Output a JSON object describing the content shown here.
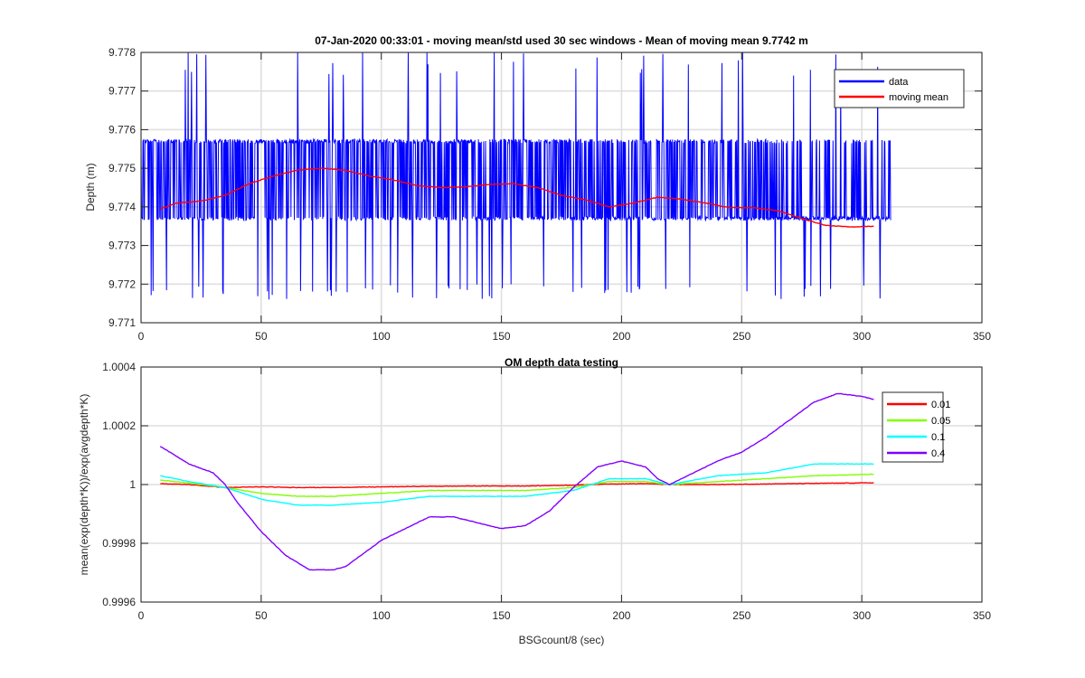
{
  "chart_data": [
    {
      "type": "line",
      "title": "07-Jan-2020 00:33:01 - moving mean/std used 30 sec windows - Mean of moving mean 9.7742 m",
      "xlabel": "",
      "ylabel": "Depth (m)",
      "xlim": [
        0,
        350
      ],
      "ylim": [
        9.771,
        9.778
      ],
      "xticks": [
        0,
        50,
        100,
        150,
        200,
        250,
        300,
        350
      ],
      "yticks": [
        9.771,
        9.772,
        9.773,
        9.774,
        9.775,
        9.776,
        9.777,
        9.778
      ],
      "ytick_labels": [
        "9.771",
        "9.772",
        "9.773",
        "9.774",
        "9.775",
        "9.776",
        "9.777",
        "9.778"
      ],
      "grid": true,
      "legend_position": "top-right",
      "series": [
        {
          "name": "data",
          "color": "#0000ff",
          "style": "noisy",
          "x_range": [
            0,
            312
          ],
          "base_levels": [
            9.7737,
            9.7757
          ],
          "spike_levels": [
            9.7716,
            9.7774,
            9.778
          ],
          "x": [
            0,
            10,
            20,
            30,
            40,
            50,
            60,
            70,
            80,
            90,
            100,
            110,
            120,
            130,
            140,
            150,
            160,
            170,
            180,
            190,
            200,
            210,
            220,
            230,
            240,
            250,
            260,
            270,
            280,
            290,
            300,
            312
          ],
          "y": [
            9.7747,
            9.7748,
            9.7747,
            9.7748,
            9.7749,
            9.775,
            9.7751,
            9.7751,
            9.7751,
            9.775,
            9.7749,
            9.7748,
            9.7748,
            9.7748,
            9.7748,
            9.7748,
            9.7747,
            9.7747,
            9.7746,
            9.7745,
            9.7745,
            9.7746,
            9.7746,
            9.7745,
            9.7745,
            9.7744,
            9.7743,
            9.7742,
            9.7741,
            9.7741,
            9.7742,
            9.7742
          ]
        },
        {
          "name": "moving mean",
          "color": "#ff0000",
          "x": [
            8,
            15,
            25,
            35,
            45,
            55,
            65,
            75,
            85,
            95,
            105,
            115,
            125,
            135,
            145,
            155,
            165,
            175,
            185,
            195,
            205,
            215,
            225,
            235,
            245,
            255,
            265,
            275,
            285,
            295,
            305
          ],
          "y": [
            9.77395,
            9.7741,
            9.77415,
            9.7743,
            9.7746,
            9.7748,
            9.77495,
            9.775,
            9.77495,
            9.7748,
            9.7747,
            9.77455,
            9.7745,
            9.77452,
            9.77458,
            9.7746,
            9.7745,
            9.7743,
            9.77418,
            9.774,
            9.7741,
            9.77425,
            9.7742,
            9.7741,
            9.77398,
            9.77398,
            9.7739,
            9.7737,
            9.77352,
            9.77348,
            9.7735
          ]
        }
      ]
    },
    {
      "type": "line",
      "title": "OM depth data testing",
      "xlabel": "BSGcount/8 (sec)",
      "ylabel": "mean(exp(depth*K))/exp(avgdepth*K)",
      "xlim": [
        0,
        350
      ],
      "ylim": [
        0.9996,
        1.0004
      ],
      "xticks": [
        0,
        50,
        100,
        150,
        200,
        250,
        300,
        350
      ],
      "yticks": [
        0.9996,
        0.9998,
        1.0,
        1.0002,
        1.0004
      ],
      "ytick_labels": [
        "0.9996",
        "0.9998",
        "1",
        "1.0002",
        "1.0004"
      ],
      "grid": true,
      "legend_position": "top-right",
      "series": [
        {
          "name": "0.01",
          "color": "#ff0000",
          "x": [
            8,
            20,
            35,
            50,
            65,
            80,
            100,
            120,
            140,
            160,
            180,
            195,
            210,
            220,
            240,
            260,
            280,
            305
          ],
          "y": [
            1.000003,
            1.0,
            0.99999,
            0.999992,
            0.99999,
            0.99999,
            0.999992,
            0.999994,
            0.999995,
            0.999995,
            0.999998,
            1.000002,
            1.000003,
            1.0,
            1.0,
            1.000002,
            1.000004,
            1.000006
          ]
        },
        {
          "name": "0.05",
          "color": "#80ff00",
          "x": [
            8,
            20,
            35,
            50,
            65,
            80,
            100,
            120,
            140,
            160,
            180,
            195,
            210,
            220,
            240,
            260,
            280,
            305
          ],
          "y": [
            1.000015,
            1.000005,
            0.99999,
            0.99997,
            0.99996,
            0.99996,
            0.99997,
            0.99998,
            0.99998,
            0.99998,
            0.99999,
            1.00001,
            1.00001,
            1.0,
            1.00001,
            1.00002,
            1.00003,
            1.000035
          ]
        },
        {
          "name": "0.1",
          "color": "#00ffff",
          "x": [
            8,
            20,
            35,
            50,
            65,
            80,
            100,
            120,
            140,
            160,
            180,
            195,
            210,
            220,
            240,
            260,
            280,
            305
          ],
          "y": [
            1.00003,
            1.00001,
            0.99999,
            0.99995,
            0.99993,
            0.99993,
            0.99994,
            0.99996,
            0.99996,
            0.99996,
            0.99998,
            1.00002,
            1.00002,
            1.0,
            1.00003,
            1.00004,
            1.00007,
            1.00007
          ]
        },
        {
          "name": "0.4",
          "color": "#8000ff",
          "x": [
            8,
            10,
            20,
            30,
            35,
            40,
            50,
            60,
            70,
            80,
            85,
            90,
            100,
            110,
            120,
            130,
            140,
            150,
            160,
            170,
            180,
            190,
            200,
            210,
            215,
            220,
            230,
            240,
            250,
            260,
            270,
            280,
            290,
            300,
            305
          ],
          "y": [
            1.00013,
            1.00012,
            1.00007,
            1.00004,
            1.0,
            0.99994,
            0.99984,
            0.99976,
            0.99971,
            0.99971,
            0.99972,
            0.99975,
            0.99981,
            0.99985,
            0.99989,
            0.99989,
            0.99987,
            0.99985,
            0.99986,
            0.99991,
            0.99999,
            1.00006,
            1.00008,
            1.00006,
            1.00002,
            1.0,
            1.00004,
            1.00008,
            1.00011,
            1.00016,
            1.00022,
            1.00028,
            1.00031,
            1.0003,
            1.00029
          ]
        }
      ]
    }
  ]
}
